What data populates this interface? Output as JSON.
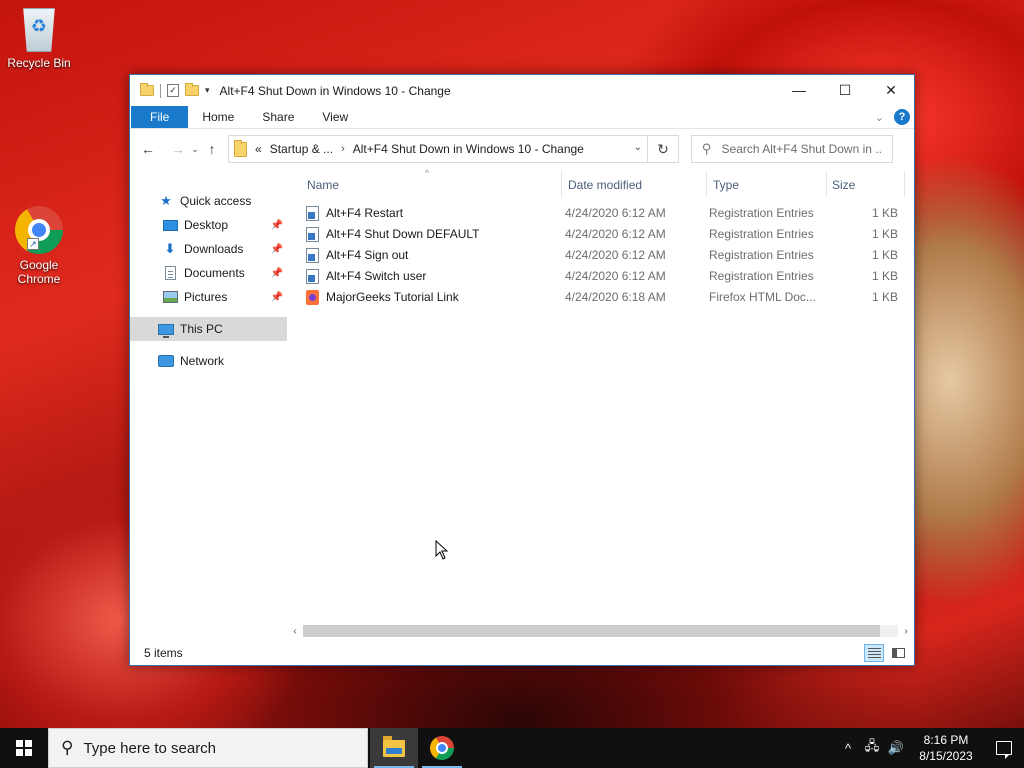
{
  "desktop": {
    "icons": [
      {
        "label": "Recycle Bin",
        "icon": "recycle-bin-icon"
      },
      {
        "label": "Google Chrome",
        "icon": "chrome-icon"
      }
    ]
  },
  "window": {
    "title": "Alt+F4 Shut Down in Windows 10 - Change",
    "controls": {
      "minimize": "—",
      "maximize": "☐",
      "close": "✕"
    },
    "ribbon_tabs": [
      "File",
      "Home",
      "Share",
      "View"
    ],
    "help": "?",
    "nav": {
      "back": "←",
      "forward": "→",
      "recent": "⌄",
      "up": "↑"
    },
    "address": {
      "prefix": "«",
      "crumbs": [
        "Startup & ...",
        "Alt+F4 Shut Down in Windows 10 - Change"
      ],
      "separator": "›"
    },
    "search_placeholder": "Search Alt+F4 Shut Down in ...",
    "nav_pane": {
      "quick_access": "Quick access",
      "pinned": [
        {
          "label": "Desktop",
          "icon": "desktop-icon"
        },
        {
          "label": "Downloads",
          "icon": "downloads-icon"
        },
        {
          "label": "Documents",
          "icon": "documents-icon"
        },
        {
          "label": "Pictures",
          "icon": "pictures-icon"
        }
      ],
      "this_pc": "This PC",
      "network": "Network"
    },
    "columns": {
      "name": "Name",
      "date": "Date modified",
      "type": "Type",
      "size": "Size"
    },
    "files": [
      {
        "name": "Alt+F4 Restart",
        "date": "4/24/2020 6:12 AM",
        "type": "Registration Entries",
        "size": "1 KB",
        "icon": "registry-file-icon"
      },
      {
        "name": "Alt+F4 Shut Down DEFAULT",
        "date": "4/24/2020 6:12 AM",
        "type": "Registration Entries",
        "size": "1 KB",
        "icon": "registry-file-icon"
      },
      {
        "name": "Alt+F4 Sign out",
        "date": "4/24/2020 6:12 AM",
        "type": "Registration Entries",
        "size": "1 KB",
        "icon": "registry-file-icon"
      },
      {
        "name": "Alt+F4 Switch user",
        "date": "4/24/2020 6:12 AM",
        "type": "Registration Entries",
        "size": "1 KB",
        "icon": "registry-file-icon"
      },
      {
        "name": "MajorGeeks Tutorial Link",
        "date": "4/24/2020 6:18 AM",
        "type": "Firefox HTML Doc...",
        "size": "1 KB",
        "icon": "firefox-html-icon"
      }
    ],
    "status": "5 items"
  },
  "taskbar": {
    "search_placeholder": "Type here to search",
    "apps": [
      {
        "name": "File Explorer",
        "icon": "file-explorer-icon",
        "active": true
      },
      {
        "name": "Google Chrome",
        "icon": "chrome-icon",
        "active": false
      }
    ],
    "clock": {
      "time": "8:16 PM",
      "date": "8/15/2023"
    }
  }
}
